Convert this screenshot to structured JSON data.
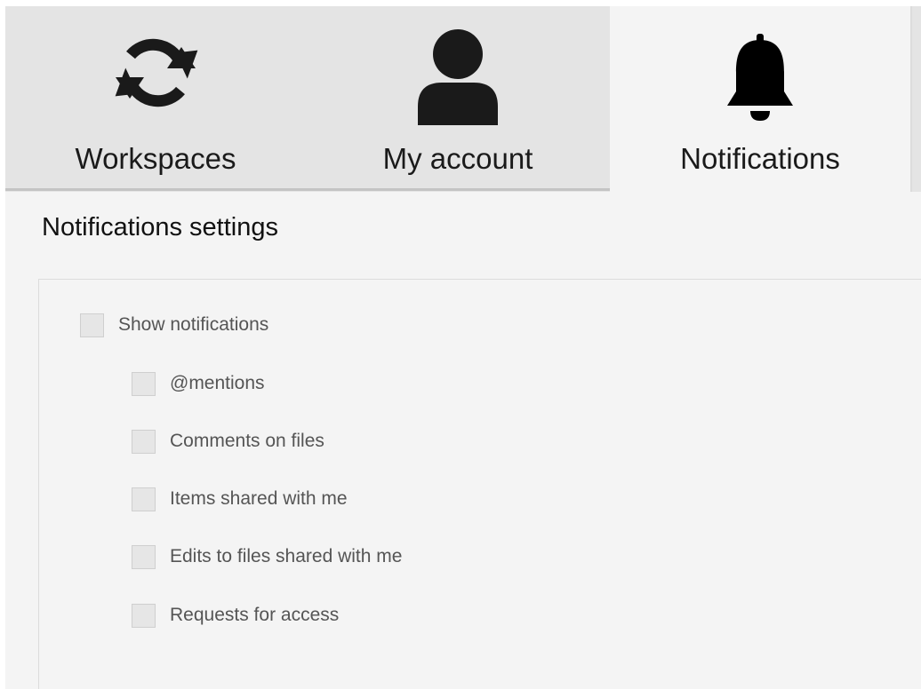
{
  "tabs": [
    {
      "label": "Workspaces",
      "icon": "sync-icon",
      "active": false
    },
    {
      "label": "My account",
      "icon": "user-icon",
      "active": false
    },
    {
      "label": "Notifications",
      "icon": "bell-icon",
      "active": true
    }
  ],
  "settings": {
    "title": "Notifications settings",
    "show_notifications": {
      "label": "Show notifications",
      "checked": false
    },
    "options": [
      {
        "label": "@mentions",
        "checked": false
      },
      {
        "label": "Comments on files",
        "checked": false
      },
      {
        "label": "Items shared with me",
        "checked": false
      },
      {
        "label": "Edits to files shared with me",
        "checked": false
      },
      {
        "label": "Requests for access",
        "checked": false
      }
    ]
  }
}
